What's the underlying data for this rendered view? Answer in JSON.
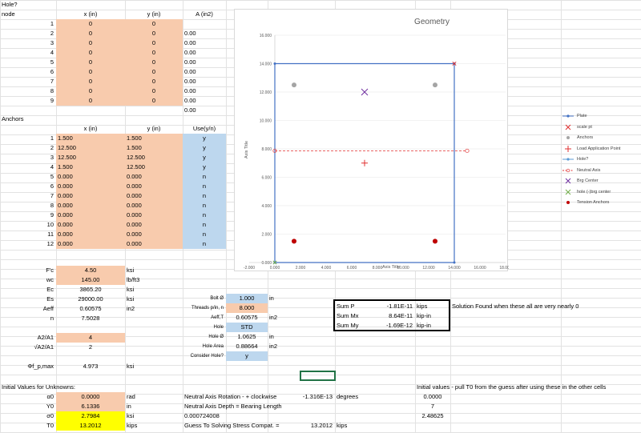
{
  "hole_section": {
    "title": "Hole?",
    "node_header": "node",
    "x_header": "x (in)",
    "y_header": "y (in)",
    "a_header": "A (in2)",
    "rows": [
      {
        "n": "1",
        "x": "0",
        "y": "0",
        "a": ""
      },
      {
        "n": "2",
        "x": "0",
        "y": "0",
        "a": "0.00"
      },
      {
        "n": "3",
        "x": "0",
        "y": "0",
        "a": "0.00"
      },
      {
        "n": "4",
        "x": "0",
        "y": "0",
        "a": "0.00"
      },
      {
        "n": "5",
        "x": "0",
        "y": "0",
        "a": "0.00"
      },
      {
        "n": "6",
        "x": "0",
        "y": "0",
        "a": "0.00"
      },
      {
        "n": "7",
        "x": "0",
        "y": "0",
        "a": "0.00"
      },
      {
        "n": "8",
        "x": "0",
        "y": "0",
        "a": "0.00"
      },
      {
        "n": "9",
        "x": "0",
        "y": "0",
        "a": "0.00"
      }
    ],
    "extra_a": "0.00"
  },
  "anchors_section": {
    "title": "Anchors",
    "x_header": "x (in)",
    "y_header": "y (in)",
    "use_header": "Use(y/n)",
    "rows": [
      {
        "n": "1",
        "x": "1.500",
        "y": "1.500",
        "u": "y"
      },
      {
        "n": "2",
        "x": "12.500",
        "y": "1.500",
        "u": "y"
      },
      {
        "n": "3",
        "x": "12.500",
        "y": "12.500",
        "u": "y"
      },
      {
        "n": "4",
        "x": "1.500",
        "y": "12.500",
        "u": "y"
      },
      {
        "n": "5",
        "x": "0.000",
        "y": "0.000",
        "u": "n"
      },
      {
        "n": "6",
        "x": "0.000",
        "y": "0.000",
        "u": "n"
      },
      {
        "n": "7",
        "x": "0.000",
        "y": "0.000",
        "u": "n"
      },
      {
        "n": "8",
        "x": "0.000",
        "y": "0.000",
        "u": "n"
      },
      {
        "n": "9",
        "x": "0.000",
        "y": "0.000",
        "u": "n"
      },
      {
        "n": "10",
        "x": "0.000",
        "y": "0.000",
        "u": "n"
      },
      {
        "n": "11",
        "x": "0.000",
        "y": "0.000",
        "u": "n"
      },
      {
        "n": "12",
        "x": "0.000",
        "y": "0.000",
        "u": "n"
      }
    ]
  },
  "properties": [
    {
      "label": "F'c",
      "value": "4.50",
      "unit": "ksi",
      "style": "orange"
    },
    {
      "label": "wc",
      "value": "145.00",
      "unit": "lb/ft3",
      "style": "orange"
    },
    {
      "label": "Ec",
      "value": "3865.20",
      "unit": "ksi",
      "style": ""
    },
    {
      "label": "Es",
      "value": "29000.00",
      "unit": "ksi",
      "style": ""
    },
    {
      "label": "Aeff",
      "value": "0.60575",
      "unit": "in2",
      "style": ""
    },
    {
      "label": "n",
      "value": "7.5028",
      "unit": "",
      "style": ""
    },
    {
      "label": "",
      "value": "",
      "unit": "",
      "style": ""
    },
    {
      "label": "A2/A1",
      "value": "4",
      "unit": "",
      "style": "orange"
    },
    {
      "label": "√A2/A1",
      "value": "2",
      "unit": "",
      "style": ""
    },
    {
      "label": "",
      "value": "",
      "unit": "",
      "style": ""
    },
    {
      "label": "Φf_p,max",
      "value": "4.973",
      "unit": "ksi",
      "style": ""
    }
  ],
  "bolt": [
    {
      "label": "Bolt Ø",
      "value": "1.000",
      "unit": "in",
      "style": "blue"
    },
    {
      "label": "Threads p/in, n",
      "value": "8.000",
      "unit": "",
      "style": "orange"
    },
    {
      "label": "Aeff,T",
      "value": "0.60575",
      "unit": "in2",
      "style": ""
    },
    {
      "label": "Hole",
      "value": "STD",
      "unit": "",
      "style": "blue"
    },
    {
      "label": "Hole Ø",
      "value": "1.0625",
      "unit": "in",
      "style": ""
    },
    {
      "label": "Hole Area",
      "value": "0.88664",
      "unit": "in2",
      "style": ""
    },
    {
      "label": "Consider Hole?",
      "value": "y",
      "unit": "",
      "style": "blue"
    }
  ],
  "sums": [
    {
      "label": "Sum P",
      "value": "-1.81E-11",
      "unit": "kips"
    },
    {
      "label": "Sum Mx",
      "value": "8.64E-11",
      "unit": "kip-in"
    },
    {
      "label": "Sum My",
      "value": "-1.69E-12",
      "unit": "kip-in"
    }
  ],
  "solution_note": "Solution Found when these all are very nearly 0",
  "unknowns": {
    "title": "Initial Values for Unknowns:",
    "rows": [
      {
        "label": "α0",
        "value": "0.0000",
        "unit": "rad",
        "desc": "Neutral Axis Rotation - + clockwise",
        "extra": "-1.316E-13",
        "extra_unit": "degrees",
        "init": "0.0000",
        "style": "orange"
      },
      {
        "label": "Y0",
        "value": "6.1336",
        "unit": "in",
        "desc": "Neutral Axis Depth = Bearing Length",
        "extra": "",
        "extra_unit": "",
        "init": "7",
        "style": "orange"
      },
      {
        "label": "σ0",
        "value": "2.7984",
        "unit": "ksi",
        "desc": "0.000724008",
        "extra": "",
        "extra_unit": "",
        "init": "2.48625",
        "style": "yellow"
      },
      {
        "label": "T0",
        "value": "13.2012",
        "unit": "kips",
        "desc": "Guess To Solving Stress Compat. =",
        "extra": "13.2012",
        "extra_unit": "kips",
        "init": "",
        "style": "yellow"
      }
    ]
  },
  "init_note": "Initial values - pull T0 from the guess after using these in the other cells",
  "chart_data": {
    "type": "scatter",
    "title": "Geometry",
    "xlabel": "Axis Title",
    "ylabel": "Axis Title",
    "xlim": [
      -2,
      18
    ],
    "ylim": [
      0,
      16
    ],
    "xticks": [
      "-2.000",
      "0.000",
      "2.000",
      "4.000",
      "6.000",
      "8.000",
      "10.000",
      "12.000",
      "14.000",
      "16.000",
      "18.000"
    ],
    "yticks": [
      "0.000",
      "2.000",
      "4.000",
      "6.000",
      "8.000",
      "10.000",
      "12.000",
      "14.000",
      "16.000"
    ],
    "series": [
      {
        "name": "Plate",
        "x": [
          0,
          14,
          14,
          0,
          0
        ],
        "y": [
          0,
          0,
          14,
          14,
          0
        ],
        "color": "#4472c4"
      },
      {
        "name": "scale pt",
        "x": [
          14
        ],
        "y": [
          14
        ],
        "color": "#e03030"
      },
      {
        "name": "Anchors",
        "x": [
          1.5,
          12.5,
          12.5,
          1.5
        ],
        "y": [
          1.5,
          1.5,
          12.5,
          12.5
        ],
        "color": "#a5a5a5"
      },
      {
        "name": "Load Application Point",
        "x": [
          7
        ],
        "y": [
          7
        ],
        "color": "#e03030"
      },
      {
        "name": "Hole?",
        "x": [
          0
        ],
        "y": [
          0
        ],
        "color": "#5b9bd5"
      },
      {
        "name": "Neutral Axis",
        "x": [
          0,
          15
        ],
        "y": [
          7.8664,
          7.8664
        ],
        "color": "#e03030"
      },
      {
        "name": "Brg Center",
        "x": [
          7
        ],
        "y": [
          12
        ],
        "color": "#7030a0"
      },
      {
        "name": "hole (-)brg center",
        "x": [
          0
        ],
        "y": [
          0
        ],
        "color": "#70ad47"
      },
      {
        "name": "Tension Anchors",
        "x": [
          1.5,
          12.5
        ],
        "y": [
          1.5,
          1.5
        ],
        "color": "#c00000"
      }
    ]
  }
}
